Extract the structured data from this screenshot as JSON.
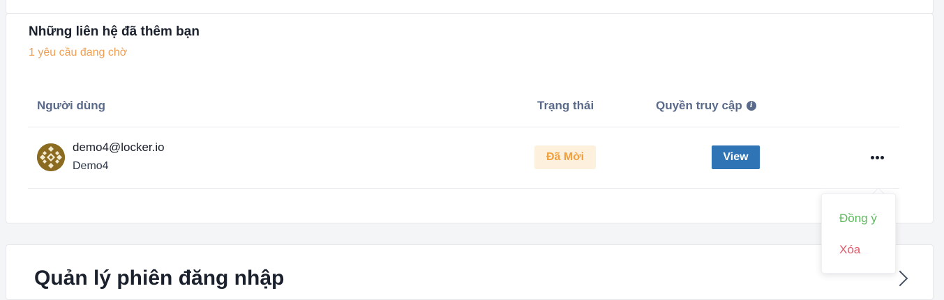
{
  "section": {
    "title": "Những liên hệ đã thêm bạn",
    "pending_text": "1 yêu cầu đang chờ"
  },
  "table": {
    "headers": {
      "user": "Người dùng",
      "status": "Trạng thái",
      "access": "Quyền truy cập"
    },
    "rows": [
      {
        "email": "demo4@locker.io",
        "name": "Demo4",
        "status": "Đã Mời",
        "access_button": "View"
      }
    ]
  },
  "dropdown_menu": {
    "items": [
      {
        "label": "Đồng ý",
        "color": "#5cb85c"
      },
      {
        "label": "Xóa",
        "color": "#e05a6a"
      }
    ]
  },
  "next_section": {
    "title": "Quản lý phiên đăng nhập"
  },
  "icons": {
    "access_info": "info-icon",
    "row_actions": "more-horizontal-icon",
    "collapse": "chevron-icon"
  },
  "colors": {
    "accent": "#2f75b5",
    "pending": "#f0a055",
    "badge_bg": "#fdf0dc",
    "badge_text": "#f0a040"
  }
}
